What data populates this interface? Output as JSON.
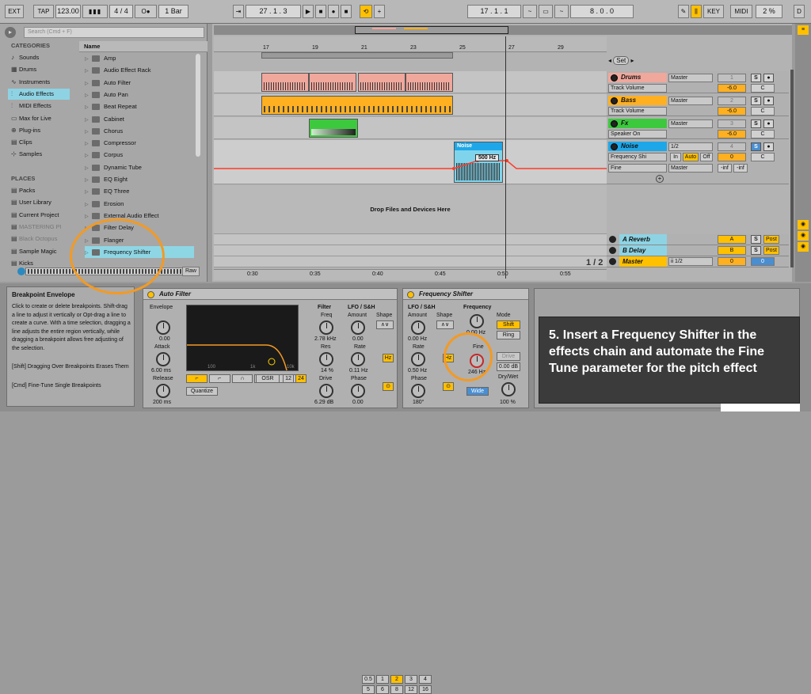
{
  "transport": {
    "ext": "EXT",
    "tap": "TAP",
    "tempo": "123.00",
    "sig": "4 / 4",
    "quant": "1 Bar",
    "position": "27 .  1 .  3",
    "loop_start": "17 .  1 .  1",
    "loop_len": "8 .  0 .  0",
    "key": "KEY",
    "midi": "MIDI",
    "cpu": "2 %",
    "d": "D"
  },
  "browser": {
    "search_placeholder": "Search (Cmd + F)",
    "categories_title": "CATEGORIES",
    "categories": [
      "Sounds",
      "Drums",
      "Instruments",
      "Audio Effects",
      "MIDI Effects",
      "Max for Live",
      "Plug-ins",
      "Clips",
      "Samples"
    ],
    "places_title": "PLACES",
    "places": [
      "Packs",
      "User Library",
      "Current Project",
      "MASTERING PI",
      "Black Octopus",
      "Sample Magic",
      "Kicks"
    ],
    "name_header": "Name",
    "items": [
      "Amp",
      "Audio Effect Rack",
      "Auto Filter",
      "Auto Pan",
      "Beat Repeat",
      "Cabinet",
      "Chorus",
      "Compressor",
      "Corpus",
      "Dynamic Tube",
      "EQ Eight",
      "EQ Three",
      "Erosion",
      "External Audio Effect",
      "Filter Delay",
      "Flanger",
      "Frequency Shifter",
      "Gate"
    ],
    "raw": "Raw"
  },
  "ruler": {
    "bars": [
      "17",
      "19",
      "21",
      "23",
      "25",
      "27",
      "29"
    ],
    "times": [
      "0:30",
      "0:35",
      "0:40",
      "0:45",
      "0:50",
      "0:55"
    ],
    "set": "Set",
    "page": "1 / 2"
  },
  "arrangement": {
    "drop_text": "Drop Files and Devices Here",
    "clip_label": "Noise",
    "auto_value": "500 Hz"
  },
  "tracks": [
    {
      "name": "Drums",
      "color": "#f0a79c",
      "route": "Master",
      "sub": "Track Volume",
      "num": "1",
      "vol": "-6.0",
      "pan": "C"
    },
    {
      "name": "Bass",
      "color": "#ffb020",
      "route": "Master",
      "sub": "Track Volume",
      "num": "2",
      "vol": "-6.0",
      "pan": "C"
    },
    {
      "name": "Fx",
      "color": "#3dc93d",
      "route": "Master",
      "sub": "Speaker On",
      "num": "3",
      "vol": "-6.0",
      "pan": "C"
    },
    {
      "name": "Noise",
      "color": "#1ea7e8",
      "route": "1/2",
      "sub": "Frequency Shi",
      "num": "4",
      "vol": "0",
      "pan": "C",
      "sub2": "Fine",
      "route2": "Master",
      "in": "In",
      "auto": "Auto",
      "off": "Off",
      "inf1": "-inf",
      "inf2": "-inf"
    }
  ],
  "returns": [
    {
      "name": "A Reverb",
      "letter": "A",
      "post": "Post"
    },
    {
      "name": "B Delay",
      "letter": "B",
      "post": "Post"
    },
    {
      "name": "Master",
      "route": "ii 1/2",
      "vol": "0",
      "pan": "0"
    }
  ],
  "info": {
    "title": "Breakpoint Envelope",
    "body": "Click to create or delete breakpoints. Shift-drag a line to adjust it vertically or Opt-drag a line to create a curve. With a time selection, dragging a line adjusts the entire region vertically, while dragging a breakpoint allows free adjusting of the selection.",
    "hint1": "[Shift] Dragging Over Breakpoints Erases Them",
    "hint2": "[Cmd] Fine-Tune Single Breakpoints"
  },
  "autofilter": {
    "title": "Auto Filter",
    "envelope": "Envelope",
    "env_val": "0.00",
    "attack": "Attack",
    "attack_val": "6.00 ms",
    "release": "Release",
    "release_val": "200 ms",
    "graph_labels": [
      "100",
      "1k",
      "10k"
    ],
    "filter": "Filter",
    "freq": "Freq",
    "freq_val": "2.78 kHz",
    "res": "Res",
    "res_val": "14 %",
    "drive": "Drive",
    "drive_val": "6.29 dB",
    "lfo": "LFO / S&H",
    "amount": "Amount",
    "amount_val": "0.00",
    "shape": "Shape",
    "rate": "Rate",
    "rate_val": "0.11 Hz",
    "phase": "Phase",
    "phase_val": "0.00",
    "hz": "Hz",
    "quantize": "Quantize",
    "q_vals": [
      "0.5",
      "1",
      "2",
      "3",
      "4"
    ],
    "q_vals2": [
      "5",
      "6",
      "8",
      "12",
      "16"
    ],
    "osr": "OSR",
    "n12": "12",
    "n24": "24"
  },
  "freqshifter": {
    "title": "Frequency Shifter",
    "lfo": "LFO / S&H",
    "amount": "Amount",
    "amount_val": "0.00 Hz",
    "shape": "Shape",
    "rate": "Rate",
    "rate_val": "0.50 Hz",
    "phase": "Phase",
    "phase_val": "180°",
    "hz": "Hz",
    "frequency": "Frequency",
    "freq_val": "0.00 Hz",
    "fine": "Fine",
    "fine_val": "246 Hz",
    "mode": "Mode",
    "shift": "Shift",
    "ring": "Ring",
    "drive": "Drive",
    "drive_val": "0.00 dB",
    "wide": "Wide",
    "drywet": "Dry/Wet",
    "drywet_val": "100 %"
  },
  "caption": {
    "text": "5. Insert a Frequency Shifter in the effects chain and automate the Fine Tune parameter for the pitch effect"
  }
}
